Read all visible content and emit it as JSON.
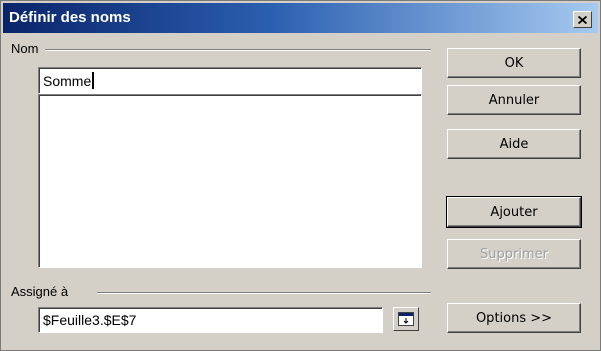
{
  "window": {
    "title": "Définir des noms"
  },
  "name_group": {
    "label": "Nom",
    "input_value": "Somme",
    "names": []
  },
  "assigned_group": {
    "label": "Assigné à",
    "input_value": "$Feuille3.$E$7"
  },
  "buttons": {
    "ok": "OK",
    "cancel": "Annuler",
    "help": "Aide",
    "add": "Ajouter",
    "delete": "Supprimer",
    "options": "Options >>"
  },
  "icons": {
    "close": "close-icon",
    "shrink": "shrink-dialog-icon"
  }
}
